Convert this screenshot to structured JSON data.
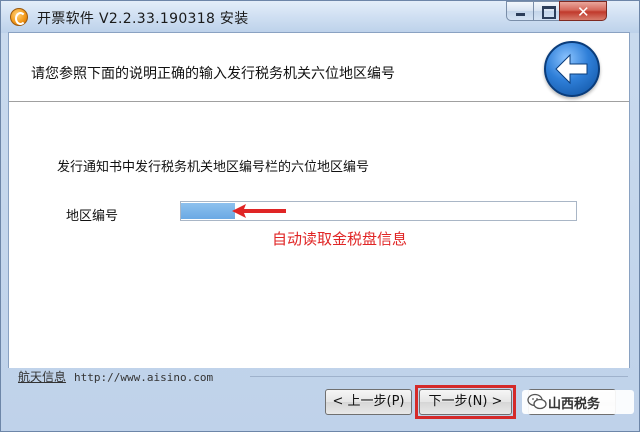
{
  "window": {
    "title": "开票软件 V2.2.33.190318 安装"
  },
  "header": {
    "instruction": "请您参照下面的说明正确的输入发行税务机关六位地区编号"
  },
  "body": {
    "notice": "发行通知书中发行税务机关地区编号栏的六位地区编号",
    "region_label": "地区编号",
    "region_value": "",
    "annotation": "自动读取金税盘信息"
  },
  "footer": {
    "brand": "航天信息",
    "url": "http://www.aisino.com"
  },
  "buttons": {
    "prev": "< 上一步(P)",
    "next": "下一步(N) >"
  },
  "watermark": {
    "text": "山西税务"
  },
  "colors": {
    "annotation_red": "#e02525",
    "highlight_red": "#d42a2a",
    "back_button_blue": "#2f7fd8"
  },
  "icons": {
    "app": "invoice-software-icon",
    "back": "back-arrow-icon",
    "watermark": "wechat-icon"
  }
}
